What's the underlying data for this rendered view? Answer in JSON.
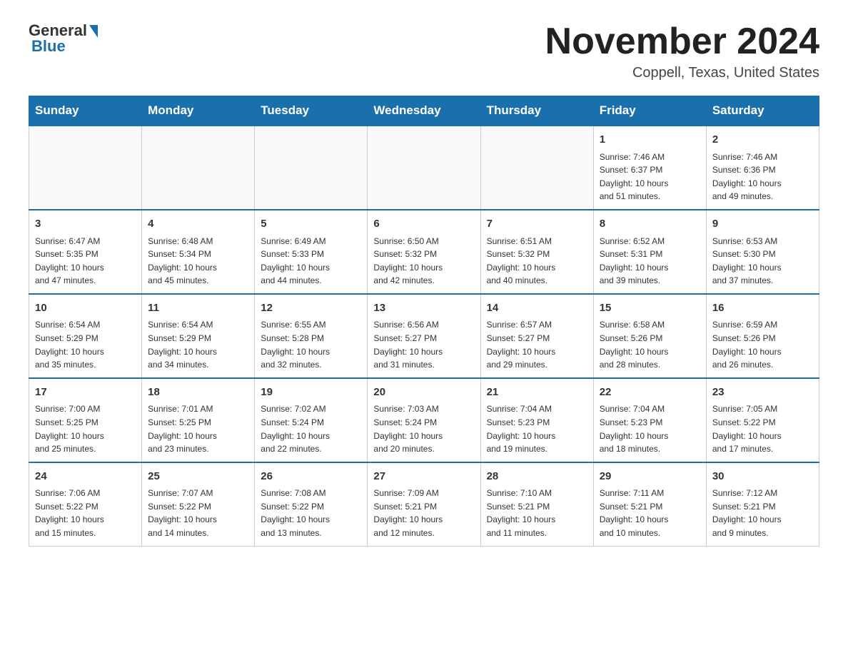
{
  "header": {
    "logo_general": "General",
    "logo_blue": "Blue",
    "month_year": "November 2024",
    "location": "Coppell, Texas, United States"
  },
  "weekdays": [
    "Sunday",
    "Monday",
    "Tuesday",
    "Wednesday",
    "Thursday",
    "Friday",
    "Saturday"
  ],
  "weeks": [
    [
      {
        "day": "",
        "info": ""
      },
      {
        "day": "",
        "info": ""
      },
      {
        "day": "",
        "info": ""
      },
      {
        "day": "",
        "info": ""
      },
      {
        "day": "",
        "info": ""
      },
      {
        "day": "1",
        "info": "Sunrise: 7:46 AM\nSunset: 6:37 PM\nDaylight: 10 hours\nand 51 minutes."
      },
      {
        "day": "2",
        "info": "Sunrise: 7:46 AM\nSunset: 6:36 PM\nDaylight: 10 hours\nand 49 minutes."
      }
    ],
    [
      {
        "day": "3",
        "info": "Sunrise: 6:47 AM\nSunset: 5:35 PM\nDaylight: 10 hours\nand 47 minutes."
      },
      {
        "day": "4",
        "info": "Sunrise: 6:48 AM\nSunset: 5:34 PM\nDaylight: 10 hours\nand 45 minutes."
      },
      {
        "day": "5",
        "info": "Sunrise: 6:49 AM\nSunset: 5:33 PM\nDaylight: 10 hours\nand 44 minutes."
      },
      {
        "day": "6",
        "info": "Sunrise: 6:50 AM\nSunset: 5:32 PM\nDaylight: 10 hours\nand 42 minutes."
      },
      {
        "day": "7",
        "info": "Sunrise: 6:51 AM\nSunset: 5:32 PM\nDaylight: 10 hours\nand 40 minutes."
      },
      {
        "day": "8",
        "info": "Sunrise: 6:52 AM\nSunset: 5:31 PM\nDaylight: 10 hours\nand 39 minutes."
      },
      {
        "day": "9",
        "info": "Sunrise: 6:53 AM\nSunset: 5:30 PM\nDaylight: 10 hours\nand 37 minutes."
      }
    ],
    [
      {
        "day": "10",
        "info": "Sunrise: 6:54 AM\nSunset: 5:29 PM\nDaylight: 10 hours\nand 35 minutes."
      },
      {
        "day": "11",
        "info": "Sunrise: 6:54 AM\nSunset: 5:29 PM\nDaylight: 10 hours\nand 34 minutes."
      },
      {
        "day": "12",
        "info": "Sunrise: 6:55 AM\nSunset: 5:28 PM\nDaylight: 10 hours\nand 32 minutes."
      },
      {
        "day": "13",
        "info": "Sunrise: 6:56 AM\nSunset: 5:27 PM\nDaylight: 10 hours\nand 31 minutes."
      },
      {
        "day": "14",
        "info": "Sunrise: 6:57 AM\nSunset: 5:27 PM\nDaylight: 10 hours\nand 29 minutes."
      },
      {
        "day": "15",
        "info": "Sunrise: 6:58 AM\nSunset: 5:26 PM\nDaylight: 10 hours\nand 28 minutes."
      },
      {
        "day": "16",
        "info": "Sunrise: 6:59 AM\nSunset: 5:26 PM\nDaylight: 10 hours\nand 26 minutes."
      }
    ],
    [
      {
        "day": "17",
        "info": "Sunrise: 7:00 AM\nSunset: 5:25 PM\nDaylight: 10 hours\nand 25 minutes."
      },
      {
        "day": "18",
        "info": "Sunrise: 7:01 AM\nSunset: 5:25 PM\nDaylight: 10 hours\nand 23 minutes."
      },
      {
        "day": "19",
        "info": "Sunrise: 7:02 AM\nSunset: 5:24 PM\nDaylight: 10 hours\nand 22 minutes."
      },
      {
        "day": "20",
        "info": "Sunrise: 7:03 AM\nSunset: 5:24 PM\nDaylight: 10 hours\nand 20 minutes."
      },
      {
        "day": "21",
        "info": "Sunrise: 7:04 AM\nSunset: 5:23 PM\nDaylight: 10 hours\nand 19 minutes."
      },
      {
        "day": "22",
        "info": "Sunrise: 7:04 AM\nSunset: 5:23 PM\nDaylight: 10 hours\nand 18 minutes."
      },
      {
        "day": "23",
        "info": "Sunrise: 7:05 AM\nSunset: 5:22 PM\nDaylight: 10 hours\nand 17 minutes."
      }
    ],
    [
      {
        "day": "24",
        "info": "Sunrise: 7:06 AM\nSunset: 5:22 PM\nDaylight: 10 hours\nand 15 minutes."
      },
      {
        "day": "25",
        "info": "Sunrise: 7:07 AM\nSunset: 5:22 PM\nDaylight: 10 hours\nand 14 minutes."
      },
      {
        "day": "26",
        "info": "Sunrise: 7:08 AM\nSunset: 5:22 PM\nDaylight: 10 hours\nand 13 minutes."
      },
      {
        "day": "27",
        "info": "Sunrise: 7:09 AM\nSunset: 5:21 PM\nDaylight: 10 hours\nand 12 minutes."
      },
      {
        "day": "28",
        "info": "Sunrise: 7:10 AM\nSunset: 5:21 PM\nDaylight: 10 hours\nand 11 minutes."
      },
      {
        "day": "29",
        "info": "Sunrise: 7:11 AM\nSunset: 5:21 PM\nDaylight: 10 hours\nand 10 minutes."
      },
      {
        "day": "30",
        "info": "Sunrise: 7:12 AM\nSunset: 5:21 PM\nDaylight: 10 hours\nand 9 minutes."
      }
    ]
  ]
}
